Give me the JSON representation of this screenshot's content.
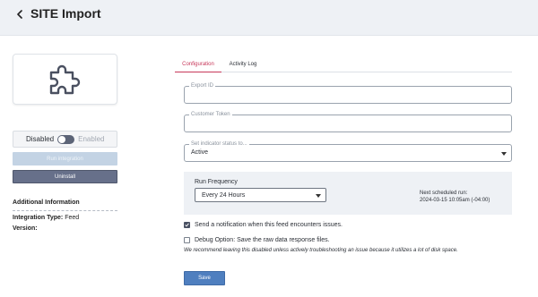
{
  "header": {
    "title": "SITE Import",
    "back_icon": "chevron-left-icon"
  },
  "integration_icon": "puzzle-piece-icon",
  "sidebar": {
    "toggle": {
      "off_label": "Disabled",
      "on_label": "Enabled",
      "state": "off"
    },
    "run_label": "Run integration",
    "uninstall_label": "Uninstall",
    "additional_info": {
      "title": "Additional Information",
      "integration_type_label": "Integration Type:",
      "integration_type_value": "Feed",
      "version_label": "Version:"
    }
  },
  "tabs": [
    {
      "label": "Configuration",
      "active": true
    },
    {
      "label": "Activity Log",
      "active": false
    }
  ],
  "form": {
    "export_id": {
      "label": "Export ID",
      "value": ""
    },
    "customer_token": {
      "label": "Customer Token",
      "value": ""
    },
    "indicator_status": {
      "label": "Set indicator status to...",
      "value": "Active"
    },
    "run_frequency": {
      "label": "Run Frequency",
      "value": "Every 24 Hours",
      "next_label": "Next scheduled run:",
      "next_value": "2024-03-15 10:05am (-04:00)"
    },
    "notify": {
      "label": "Send a notification when this feed encounters issues.",
      "checked": true
    },
    "debug": {
      "label": "Debug Option: Save the raw data response files.",
      "checked": false,
      "note": "We recommend leaving this disabled unless actively troubleshooting an issue because it utilizes a lot of disk space."
    },
    "save_label": "Save"
  },
  "colors": {
    "accent_tab": "#c7385a",
    "save_button": "#4f7fbf",
    "uninstall_button": "#67708a",
    "run_button_disabled": "#c3d3e4",
    "header_bg": "#eef1f5"
  }
}
